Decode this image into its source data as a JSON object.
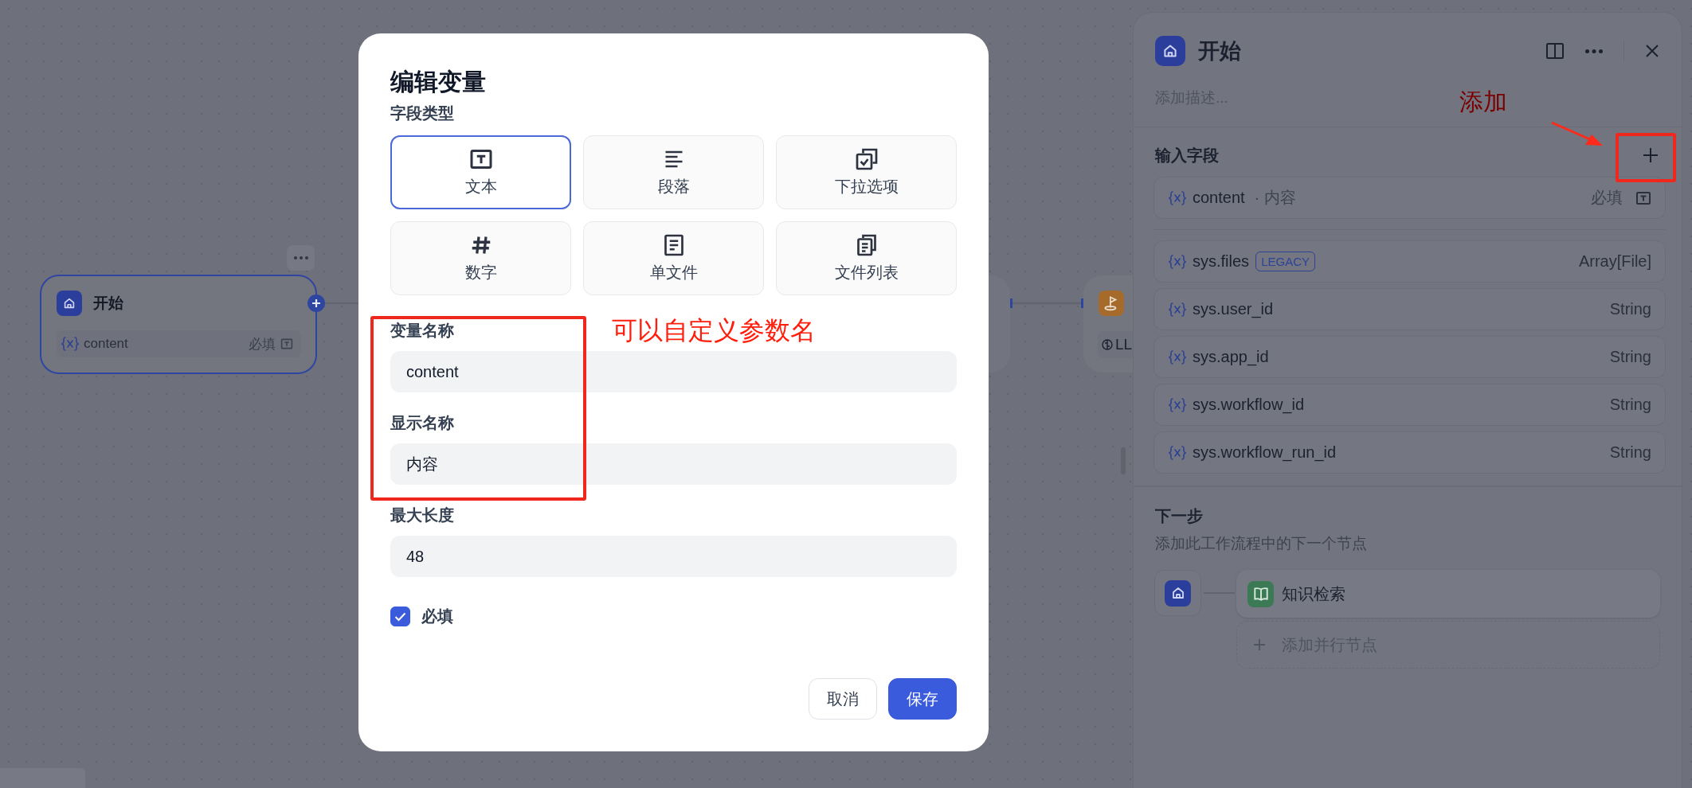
{
  "canvas": {
    "start_node": {
      "title": "开始",
      "selected": true,
      "variable": "content",
      "tag": "必填"
    },
    "llm_node": {
      "chip_text": "LL"
    }
  },
  "dialog": {
    "title": "编辑变量",
    "type_label": "字段类型",
    "types": [
      {
        "label": "文本",
        "kind": "text",
        "selected": true
      },
      {
        "label": "段落",
        "kind": "paragraph",
        "selected": false
      },
      {
        "label": "下拉选项",
        "kind": "select",
        "selected": false
      },
      {
        "label": "数字",
        "kind": "number",
        "selected": false
      },
      {
        "label": "单文件",
        "kind": "file",
        "selected": false
      },
      {
        "label": "文件列表",
        "kind": "file-list",
        "selected": false
      }
    ],
    "fields": [
      {
        "label": "变量名称",
        "value": "content"
      },
      {
        "label": "显示名称",
        "value": "内容"
      },
      {
        "label": "最大长度",
        "value": "48"
      }
    ],
    "required": {
      "label": "必填",
      "checked": true
    },
    "buttons": [
      {
        "label": "取消",
        "kind": "secondary"
      },
      {
        "label": "保存",
        "kind": "primary"
      }
    ]
  },
  "panel": {
    "title": "开始",
    "description": {
      "placeholder": "添加描述..."
    },
    "inputs_heading": "输入字段",
    "input_fields": [
      {
        "name": "content",
        "display": "· 内容",
        "tag": "必填"
      }
    ],
    "system_fields": [
      {
        "name": "sys.files",
        "badge": "LEGACY",
        "type": "Array[File]"
      },
      {
        "name": "sys.user_id",
        "type": "String"
      },
      {
        "name": "sys.app_id",
        "type": "String"
      },
      {
        "name": "sys.workflow_id",
        "type": "String"
      },
      {
        "name": "sys.workflow_run_id",
        "type": "String"
      }
    ],
    "next_heading": "下一步",
    "next_hint": "添加此工作流程中的下一个节点",
    "next_nodes": [
      {
        "title": "知识检索"
      }
    ],
    "add_parallel": "添加并行节点"
  },
  "annotations": [
    {
      "text": "添加",
      "kind": "add"
    },
    {
      "text": "可以自定义参数名",
      "kind": "rename"
    }
  ]
}
